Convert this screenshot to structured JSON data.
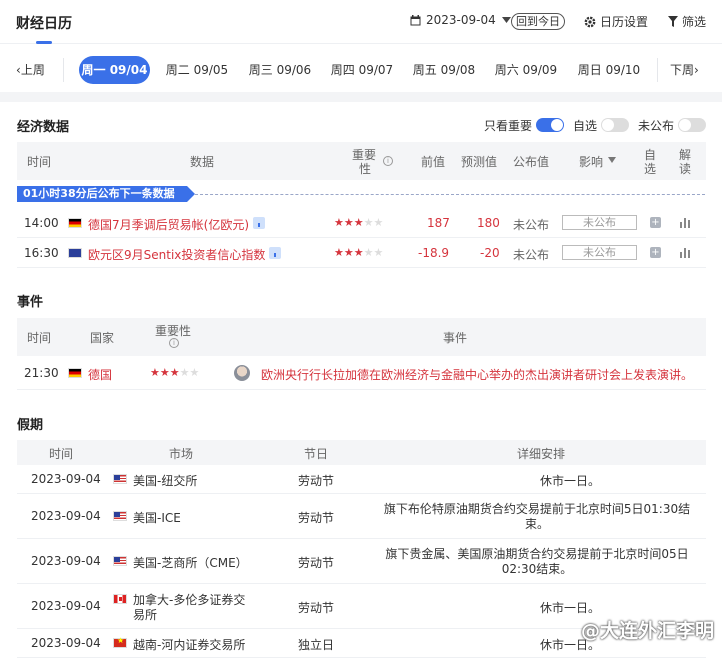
{
  "header": {
    "title": "财经日历",
    "date": "2023-09-04",
    "today_button": "回到今日",
    "settings": "日历设置",
    "filter": "筛选"
  },
  "week": {
    "prev": "上周",
    "next": "下周",
    "days": [
      "周一 09/04",
      "周二 09/05",
      "周三 09/06",
      "周四 09/07",
      "周五 09/08",
      "周六 09/09",
      "周日 09/10"
    ],
    "selected_index": 0
  },
  "econ": {
    "title": "经济数据",
    "filters": [
      {
        "label": "只看重要",
        "on": true
      },
      {
        "label": "自选",
        "on": false
      },
      {
        "label": "未公布",
        "on": false
      }
    ],
    "columns": {
      "time": "时间",
      "data": "数据",
      "importance_1": "重要",
      "importance_2": "性",
      "previous": "前值",
      "forecast": "预测值",
      "actual": "公布值",
      "impact": "影响",
      "watch_1": "自",
      "watch_2": "选",
      "explain_1": "解",
      "explain_2": "读"
    },
    "countdown": "01小时38分后公布下一条数据",
    "rows": [
      {
        "time": "14:00",
        "name": "德国7月季调后贸易帐(亿欧元)",
        "stars": 3,
        "previous": "187",
        "forecast": "180",
        "actual": "未公布",
        "impact": "未公布"
      },
      {
        "time": "16:30",
        "name": "欧元区9月Sentix投资者信心指数",
        "stars": 3,
        "previous": "-18.9",
        "forecast": "-20",
        "actual": "未公布",
        "impact": "未公布"
      }
    ]
  },
  "events": {
    "title": "事件",
    "columns": {
      "time": "时间",
      "country": "国家",
      "importance": "重要性",
      "event": "事件"
    },
    "rows": [
      {
        "time": "21:30",
        "country": "德国",
        "stars": 3,
        "event": "欧洲央行行长拉加德在欧洲经济与金融中心举办的杰出演讲者研讨会上发表演讲。"
      }
    ]
  },
  "holidays": {
    "title": "假期",
    "columns": {
      "time": "时间",
      "market": "市场",
      "holiday": "节日",
      "detail": "详细安排"
    },
    "rows": [
      {
        "date": "2023-09-04",
        "market": "美国-纽交所",
        "holiday": "劳动节",
        "detail_1": "休市一日。",
        "detail_2": ""
      },
      {
        "date": "2023-09-04",
        "market": "美国-ICE",
        "holiday": "劳动节",
        "detail_1": "旗下布伦特原油期货合约交易提前于北京时间5日01:30结",
        "detail_2": "束。"
      },
      {
        "date": "2023-09-04",
        "market": "美国-芝商所（CME）",
        "holiday": "劳动节",
        "detail_1": "旗下贵金属、美国原油期货合约交易提前于北京时间05日",
        "detail_2": "02:30结束。"
      },
      {
        "date": "2023-09-04",
        "market_1": "加拿大-多伦多证券交",
        "market_2": "易所",
        "holiday": "劳动节",
        "detail_1": "休市一日。",
        "detail_2": ""
      },
      {
        "date": "2023-09-04",
        "market": "越南-河内证券交易所",
        "holiday": "独立日",
        "detail_1": "休市一日。",
        "detail_2": ""
      }
    ]
  },
  "watermark": "@大连外汇李明"
}
